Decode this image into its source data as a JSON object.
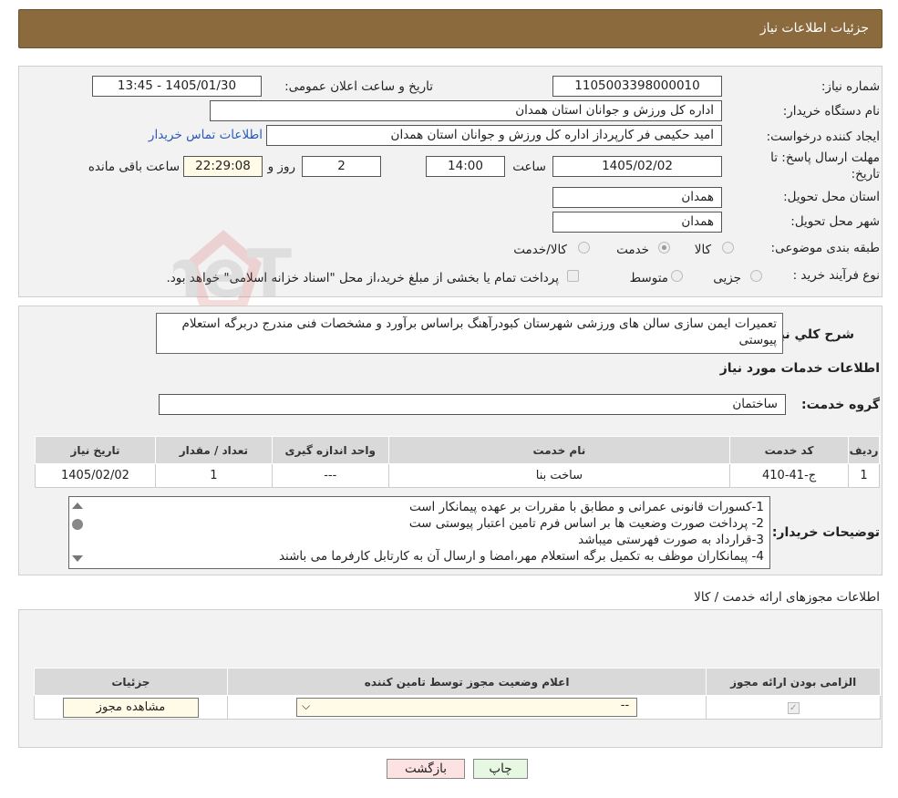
{
  "header": {
    "title": "جزئیات اطلاعات نیاز"
  },
  "need": {
    "number_label": "شماره نیاز:",
    "number": "1105003398000010",
    "announce_label": "تاریخ و ساعت اعلان عمومی:",
    "announce_value": "1405/01/30 - 13:45",
    "buyer_label": "نام دستگاه خریدار:",
    "buyer": "اداره کل ورزش و جوانان استان همدان",
    "creator_label": "ایجاد کننده درخواست:",
    "creator": "امید حکیمی فر کارپرداز اداره کل ورزش و جوانان استان همدان",
    "contact_link": "اطلاعات تماس خریدار",
    "deadline_label_1": "مهلت ارسال پاسخ: تا",
    "deadline_label_2": "تاریخ:",
    "deadline_date": "1405/02/02",
    "time_label": "ساعت",
    "deadline_time": "14:00",
    "days_value": "2",
    "days_label": "روز و",
    "remaining_time": "22:29:08",
    "remaining_label": "ساعت باقی مانده",
    "province_label": "استان محل تحویل:",
    "province": "همدان",
    "city_label": "شهر محل تحویل:",
    "city": "همدان",
    "category_label": "طبقه بندی موضوعی:",
    "category_options": [
      "کالا",
      "خدمت",
      "کالا/خدمت"
    ],
    "category_selected": "خدمت",
    "process_label": "نوع فرآیند خرید :",
    "process_options": [
      "جزیی",
      "متوسط"
    ],
    "process_note": "پرداخت تمام یا بخشی از مبلغ خرید،از محل \"اسناد خزانه اسلامی\" خواهد بود."
  },
  "summary": {
    "label": "شرح کلي نياز:",
    "text": "تعمیرات ایمن سازی سالن های ورزشی شهرستان کبودرآهنگ براساس برآورد و مشخصات فنی مندرج دربرگه استعلام پیوستی"
  },
  "services": {
    "section_title": "اطلاعات خدمات مورد نياز",
    "group_label": "گروه خدمت:",
    "group_value": "ساختمان",
    "columns": [
      "ردیف",
      "کد خدمت",
      "نام خدمت",
      "واحد اندازه گیری",
      "تعداد / مقدار",
      "تاریخ نیاز"
    ],
    "rows": [
      [
        "1",
        "ج-41-410",
        "ساخت بنا",
        "---",
        "1",
        "1405/02/02"
      ]
    ]
  },
  "buyer_notes": {
    "label": "توضیحات خریدار:",
    "lines": [
      "1-کسورات قانونی عمرانی و مطابق با مقررات بر عهده پیمانکار است",
      "2- پرداخت صورت وضعیت ها بر اساس فرم تامین اعتبار پیوستی ست",
      "3-قرارداد به صورت فهرستی میباشد",
      "4- پیمانکاران موظف به تکمیل برگه استعلام مهر،امضا و ارسال آن به کارتابل کارفرما می باشند"
    ]
  },
  "permits": {
    "section_title": "اطلاعات مجوزهای ارائه خدمت / کالا",
    "columns": [
      "الزامی بودن ارائه مجوز",
      "اعلام وضعیت مجوز توسط تامین کننده",
      "جزئیات"
    ],
    "select_value": "--",
    "view_button": "مشاهده مجوز"
  },
  "footer": {
    "print_label": "چاپ",
    "back_label": "بازگشت"
  },
  "watermark": "AriaTender.neT",
  "colors": {
    "header_bg": "#8b6a3e",
    "back_btn_bg": "#fde2e2",
    "print_btn_bg": "#e6f7e2",
    "link": "#2a5bb8"
  }
}
